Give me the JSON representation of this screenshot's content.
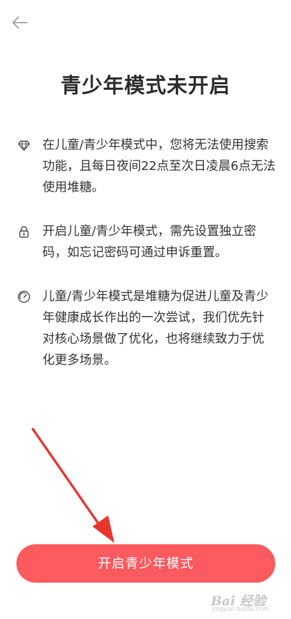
{
  "header": {
    "back_icon": "arrow-left-icon"
  },
  "title": "青少年模式未开启",
  "items": [
    {
      "icon": "diamond-icon",
      "text": "在儿童/青少年模式中，您将无法使用搜索功能，且每日夜间22点至次日凌晨6点无法使用堆糖。"
    },
    {
      "icon": "lock-icon",
      "text": "开启儿童/青少年模式，需先设置独立密码，如忘记密码可通过申诉重置。"
    },
    {
      "icon": "gauge-icon",
      "text": "儿童/青少年模式是堆糖为促进儿童及青少年健康成长作出的一次尝试，我们优先针对核心场景做了优化，也将继续致力于优化更多场景。"
    }
  ],
  "button": {
    "label": "开启青少年模式",
    "color": "#fb5a5e"
  },
  "annotation": {
    "arrow_color": "#e8352e"
  },
  "watermark": {
    "main": "Bai 经验",
    "sub": "jingyan.baidu.com"
  }
}
